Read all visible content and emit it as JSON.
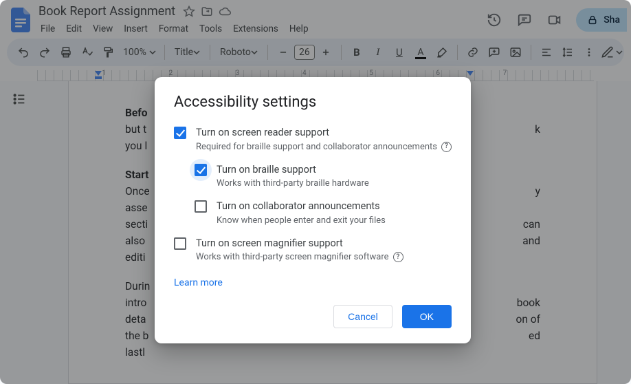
{
  "header": {
    "doc_title": "Book Report Assignment",
    "menus": [
      "File",
      "Edit",
      "View",
      "Insert",
      "Format",
      "Tools",
      "Extensions",
      "Help"
    ],
    "share_label": "Sha"
  },
  "toolbar": {
    "zoom": "100%",
    "style_select": "Title",
    "font_select": "Roboto",
    "font_size": "26"
  },
  "ruler": {
    "marks": [
      "1",
      "2",
      "3",
      "4",
      "5",
      "6",
      "7"
    ]
  },
  "document": {
    "p1_bold": "Befo",
    "p1_rest_1": "but t",
    "p1_rest_2": "you l",
    "p1_tail_1": "k",
    "p2_bold": "Start",
    "p2_l1": "Once",
    "p2_l2": "asse",
    "p2_l3": "secti",
    "p2_l4": "also",
    "p2_l5": "editi",
    "p2_tail_1": "y",
    "p2_tail_3": "can",
    "p2_tail_4": "and",
    "p3_l1": "Durin",
    "p3_l2": "intro",
    "p3_l3": "deta",
    "p3_l4": "the b",
    "p3_l5": "lastl",
    "p3_tail_2": "book",
    "p3_tail_3": "on of",
    "p3_tail_4": "ed"
  },
  "dialog": {
    "title": "Accessibility settings",
    "learn_more": "Learn more",
    "cancel": "Cancel",
    "ok": "OK",
    "options": [
      {
        "label": "Turn on screen reader support",
        "desc": "Required for braille support and collaborator announcements",
        "checked": true,
        "help": true,
        "nested": false,
        "ringed": false
      },
      {
        "label": "Turn on braille support",
        "desc": "Works with third-party braille hardware",
        "checked": true,
        "help": false,
        "nested": true,
        "ringed": true
      },
      {
        "label": "Turn on collaborator announcements",
        "desc": "Know when people enter and exit your files",
        "checked": false,
        "help": false,
        "nested": true,
        "ringed": false
      },
      {
        "label": "Turn on screen magnifier support",
        "desc": "Works with third-party screen magnifier software",
        "checked": false,
        "help": true,
        "nested": false,
        "ringed": false
      }
    ]
  }
}
